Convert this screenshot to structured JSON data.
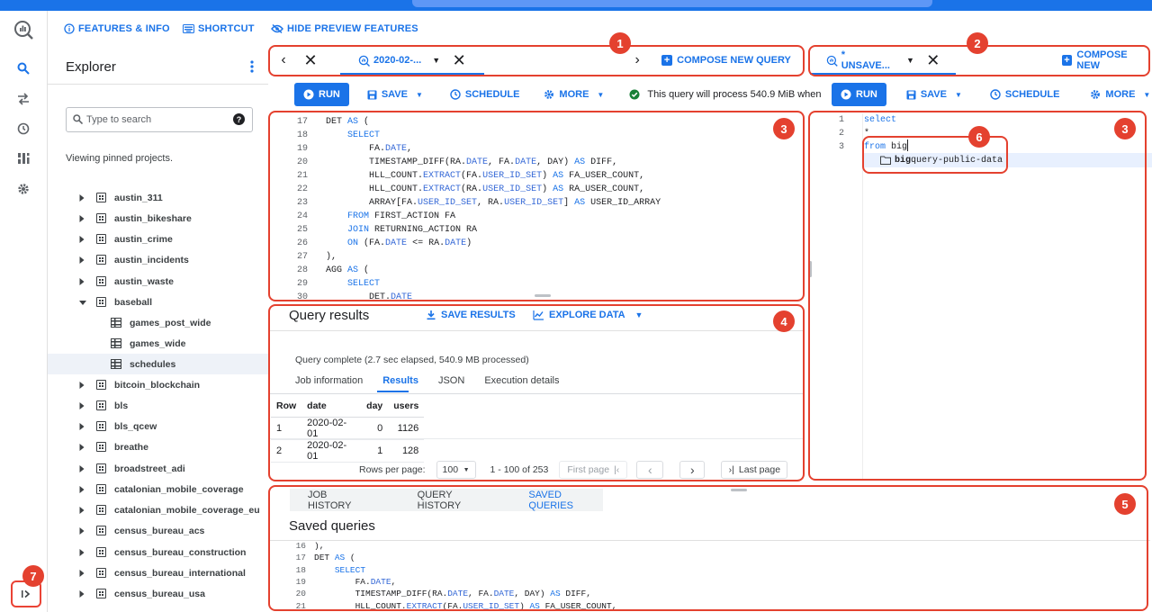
{
  "header": {
    "features_info": "FEATURES & INFO",
    "shortcut": "SHORTCUT",
    "hide_preview": "HIDE PREVIEW FEATURES"
  },
  "explorer": {
    "title": "Explorer",
    "search_placeholder": "Type to search",
    "viewing_text": "Viewing pinned projects.",
    "datasets": [
      {
        "name": "austin_311"
      },
      {
        "name": "austin_bikeshare"
      },
      {
        "name": "austin_crime"
      },
      {
        "name": "austin_incidents"
      },
      {
        "name": "austin_waste"
      },
      {
        "name": "baseball",
        "expanded": true
      },
      {
        "name": "games_post_wide",
        "table": true
      },
      {
        "name": "games_wide",
        "table": true
      },
      {
        "name": "schedules",
        "table": true,
        "selected": true
      },
      {
        "name": "bitcoin_blockchain"
      },
      {
        "name": "bls"
      },
      {
        "name": "bls_qcew"
      },
      {
        "name": "breathe"
      },
      {
        "name": "broadstreet_adi"
      },
      {
        "name": "catalonian_mobile_coverage"
      },
      {
        "name": "catalonian_mobile_coverage_eu"
      },
      {
        "name": "census_bureau_acs"
      },
      {
        "name": "census_bureau_construction"
      },
      {
        "name": "census_bureau_international"
      },
      {
        "name": "census_bureau_usa"
      }
    ]
  },
  "badges": [
    "1",
    "2",
    "3",
    "3",
    "4",
    "5",
    "6",
    "7"
  ],
  "left_tabs": {
    "tab_title": "2020-02-...",
    "compose": "COMPOSE NEW QUERY"
  },
  "right_tabs": {
    "tab_title": "* UNSAVE...",
    "compose": "COMPOSE NEW"
  },
  "toolbar": {
    "run": "RUN",
    "save": "SAVE",
    "schedule": "SCHEDULE",
    "more": "MORE",
    "estimate": "This query will process 540.9 MiB when"
  },
  "left_editor": {
    "lines": [
      {
        "n": "17",
        "t": "DET AS ("
      },
      {
        "n": "18",
        "t": "    SELECT"
      },
      {
        "n": "19",
        "t": "        FA.DATE,"
      },
      {
        "n": "20",
        "t": "        TIMESTAMP_DIFF(RA.DATE, FA.DATE, DAY) AS DIFF,"
      },
      {
        "n": "21",
        "t": "        HLL_COUNT.EXTRACT(FA.USER_ID_SET) AS FA_USER_COUNT,"
      },
      {
        "n": "22",
        "t": "        HLL_COUNT.EXTRACT(RA.USER_ID_SET) AS RA_USER_COUNT,"
      },
      {
        "n": "23",
        "t": "        ARRAY[FA.USER_ID_SET, RA.USER_ID_SET] AS USER_ID_ARRAY"
      },
      {
        "n": "24",
        "t": "    FROM FIRST_ACTION FA"
      },
      {
        "n": "25",
        "t": "    JOIN RETURNING_ACTION RA"
      },
      {
        "n": "26",
        "t": "    ON (FA.DATE <= RA.DATE)"
      },
      {
        "n": "27",
        "t": "),"
      },
      {
        "n": "28",
        "t": "AGG AS ("
      },
      {
        "n": "29",
        "t": "    SELECT"
      },
      {
        "n": "30",
        "t": "        DET.DATE"
      }
    ]
  },
  "right_editor": {
    "lines": [
      {
        "n": "1",
        "t": "select"
      },
      {
        "n": "2",
        "t": "*"
      },
      {
        "n": "3",
        "t": "from big"
      }
    ],
    "suggestion_match": "big",
    "suggestion_rest": "query-public-data"
  },
  "results": {
    "title": "Query results",
    "save_results": "SAVE RESULTS",
    "explore_data": "EXPLORE DATA",
    "status": "Query complete (2.7 sec elapsed, 540.9 MB processed)",
    "tabs": [
      "Job information",
      "Results",
      "JSON",
      "Execution details"
    ],
    "columns": [
      "Row",
      "date",
      "day",
      "users"
    ],
    "rows": [
      [
        "1",
        "2020-02-01",
        "0",
        "1126"
      ],
      [
        "2",
        "2020-02-01",
        "1",
        "128"
      ]
    ],
    "rows_per_page_label": "Rows per page:",
    "rows_per_page": "100",
    "range": "1 - 100 of 253",
    "first_page": "First page",
    "last_page": "Last page"
  },
  "bottom": {
    "tabs": [
      "JOB HISTORY",
      "QUERY HISTORY",
      "SAVED QUERIES"
    ],
    "title": "Saved queries",
    "lines": [
      {
        "n": "16",
        "t": "),"
      },
      {
        "n": "17",
        "t": "DET AS ("
      },
      {
        "n": "18",
        "t": "    SELECT"
      },
      {
        "n": "19",
        "t": "        FA.DATE,"
      },
      {
        "n": "20",
        "t": "        TIMESTAMP_DIFF(RA.DATE, FA.DATE, DAY) AS DIFF,"
      },
      {
        "n": "21",
        "t": "        HLL_COUNT.EXTRACT(FA.USER_ID_SET) AS FA_USER_COUNT,"
      }
    ]
  },
  "colors": {
    "accent": "#1a73e8",
    "highlight": "#e4412f",
    "success": "#188038"
  }
}
